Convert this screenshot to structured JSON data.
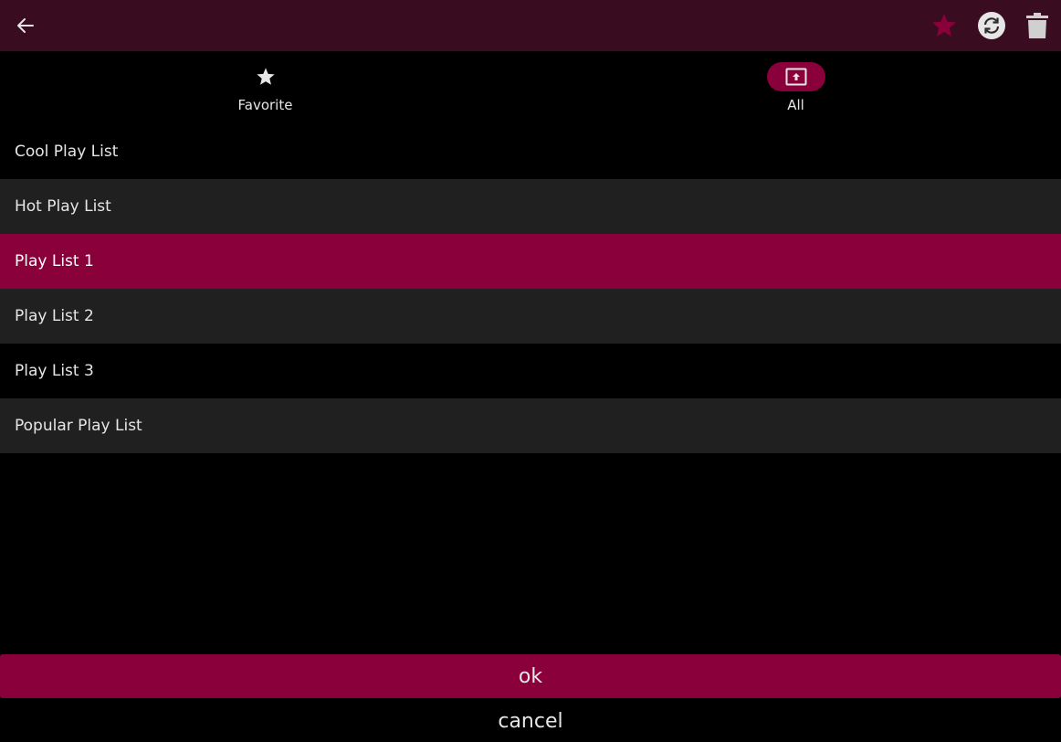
{
  "colors": {
    "accent": "#8a003a",
    "topbar": "#3a0c1f",
    "row_alt": "#202020",
    "background": "#000000",
    "text": "#e6e6e6"
  },
  "topbar": {
    "back_icon": "arrow-left-icon",
    "actions": [
      {
        "icon": "star-icon"
      },
      {
        "icon": "sync-icon"
      },
      {
        "icon": "trash-icon"
      }
    ]
  },
  "tabs": [
    {
      "label": "Favorite",
      "icon": "star-icon",
      "selected": false
    },
    {
      "label": "All",
      "icon": "upload-box-icon",
      "selected": true
    }
  ],
  "playlists": [
    {
      "label": "Cool Play List",
      "selected": false
    },
    {
      "label": "Hot Play List",
      "selected": false
    },
    {
      "label": "Play List 1",
      "selected": true
    },
    {
      "label": "Play List 2",
      "selected": false
    },
    {
      "label": "Play List 3",
      "selected": false
    },
    {
      "label": "Popular Play List",
      "selected": false
    }
  ],
  "buttons": {
    "ok": "ok",
    "cancel": "cancel"
  }
}
